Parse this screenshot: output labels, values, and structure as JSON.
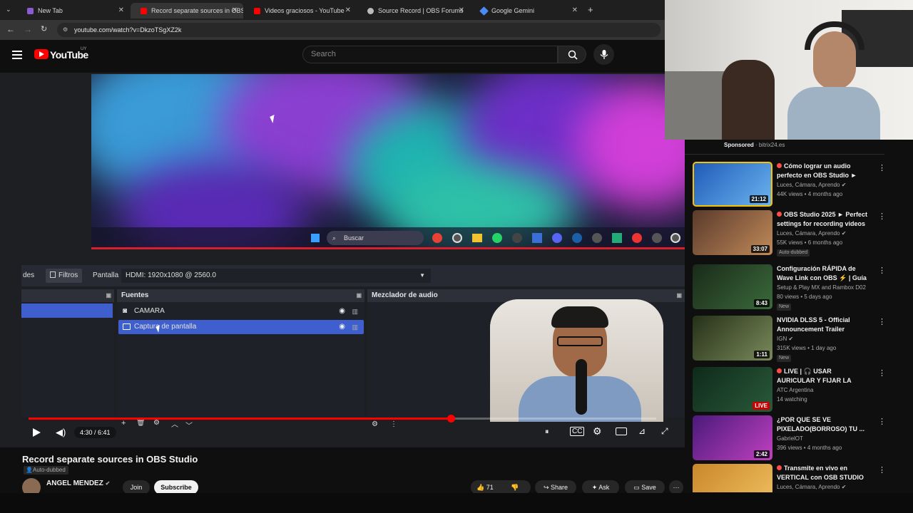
{
  "browser": {
    "tabs": [
      {
        "title": "New Tab",
        "color": "#8a5cd0"
      },
      {
        "title": "Record separate sources in OBS",
        "color": "#ff0000"
      },
      {
        "title": "Videos graciosos - YouTube",
        "color": "#ff0000"
      },
      {
        "title": "Source Record | OBS Forums",
        "color": "#bbbbbb"
      },
      {
        "title": "Google Gemini",
        "color": "#4a8bf5"
      }
    ],
    "new_tab_glyph": "+",
    "url": "youtube.com/watch?v=DkzoTSgXZ2k"
  },
  "youtube": {
    "logo_text": "YouTube",
    "country_code": "UY",
    "search_placeholder": "Search"
  },
  "obs": {
    "taskbar_search": "Buscar",
    "toolbar": {
      "cut_label": "des",
      "filters_label": "Filtros",
      "display_label": "Pantalla",
      "display_value": "HDMI: 1920x1080 @ 2560.0"
    },
    "sources_title": "Fuentes",
    "mixer_title": "Mezclador de audio",
    "sources": [
      {
        "name": "CAMARA",
        "selected": false
      },
      {
        "name": "Captura de pantalla",
        "selected": true
      }
    ]
  },
  "player": {
    "current_time": "4:30",
    "duration": "6:41",
    "timecode": "4:30 / 6:41",
    "progress": 0.673
  },
  "video": {
    "title": "Record separate sources in OBS Studio",
    "auto_dubbed": "Auto-dubbed",
    "channel": "ANGEL MENDEZ",
    "join_label": "Join",
    "subscribe_label": "Subscribe",
    "likes": "71",
    "share_label": "Share",
    "ask_label": "Ask",
    "save_label": "Save"
  },
  "sidebar": {
    "sponsored_label": "Sponsored",
    "sponsored_domain": "bitrix24.es",
    "suggestions": [
      {
        "title": "Cómo lograr un audio perfecto en OBS Studio ► ¡Sin...",
        "channel": "Luces, Cámara, Aprendo",
        "meta": "44K views • 4 months ago",
        "duration": "21:12",
        "badge": "",
        "thumb_color": "#2b6fc9"
      },
      {
        "title": "OBS Studio 2025 ► Perfect settings for recording videos",
        "channel": "Luces, Cámara, Aprendo",
        "meta": "55K views • 6 months ago",
        "duration": "33:07",
        "badge": "Auto-dubbed",
        "thumb_color": "#8c5a3a"
      },
      {
        "title": "Configuración RÁPIDA de Wave Link con OBS ⚡ | Guía en ...",
        "channel": "Setup & Play MX and Rambox D02",
        "meta": "80 views • 5 days ago",
        "duration": "8:43",
        "badge": "New",
        "thumb_color": "#2a2e3a"
      },
      {
        "title": "NVIDIA DLSS 5 - Official Announcement Trailer",
        "channel": "IGN",
        "meta": "315K views • 1 day ago",
        "duration": "1:11",
        "badge": "New",
        "thumb_color": "#3a4a2a"
      },
      {
        "title": "LIVE | 🎧 USAR AURICULAR Y FIJAR LA CALIDAD EN 1080...",
        "channel": "ATC Argentina",
        "meta": "14 watching",
        "duration": "LIVE",
        "badge": "",
        "thumb_color": "#1d3b2a"
      },
      {
        "title": "¿POR QUE SE VE PIXELADO(BORROSO) TU ...",
        "channel": "GabrielOT",
        "meta": "396 views • 4 months ago",
        "duration": "2:42",
        "badge": "",
        "thumb_color": "#6a2a8a"
      },
      {
        "title": "Transmite en vivo en VERTICAL con OSB STUDIO",
        "channel": "Luces, Cámara, Aprendo",
        "meta": "",
        "duration": "",
        "badge": "",
        "thumb_color": "#c9872b"
      }
    ]
  }
}
